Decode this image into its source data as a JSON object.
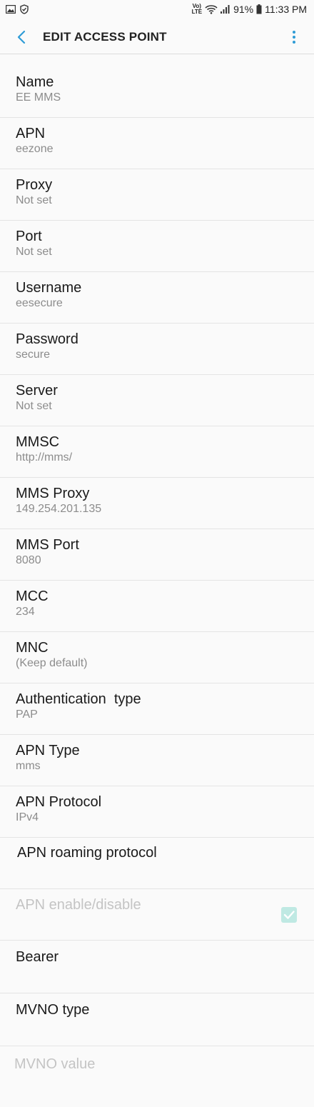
{
  "status_bar": {
    "volte": "Vo)\nLTE",
    "battery": "91%",
    "time": "11:33 PM"
  },
  "app_bar": {
    "title": "EDIT ACCESS POINT"
  },
  "fields": [
    {
      "title": "Name",
      "value": "EE MMS"
    },
    {
      "title": "APN",
      "value": "eezone"
    },
    {
      "title": "Proxy",
      "value": "Not set"
    },
    {
      "title": "Port",
      "value": "Not set"
    },
    {
      "title": "Username",
      "value": "eesecure"
    },
    {
      "title": "Password",
      "value": "secure"
    },
    {
      "title": "Server",
      "value": "Not set"
    },
    {
      "title": "MMSC",
      "value": "http://mms/"
    },
    {
      "title": "MMS Proxy",
      "value": "149.254.201.135"
    },
    {
      "title": "MMS Port",
      "value": "8080"
    },
    {
      "title": "MCC",
      "value": "234"
    },
    {
      "title": "MNC",
      "value": "(Keep default)"
    },
    {
      "title": "Authentication  type",
      "value": "PAP"
    },
    {
      "title": "APN Type",
      "value": "mms"
    },
    {
      "title": "APN Protocol",
      "value": "IPv4"
    },
    {
      "title": "APN roaming protocol",
      "value": ""
    },
    {
      "title": "APN enable/disable",
      "value": "",
      "checked": true
    },
    {
      "title": "Bearer",
      "value": ""
    },
    {
      "title": "MVNO type",
      "value": ""
    },
    {
      "title": "MVNO value",
      "value": ""
    }
  ],
  "colors": {
    "accent": "#2e9bd6",
    "checkbox": "#bfe9e3"
  }
}
